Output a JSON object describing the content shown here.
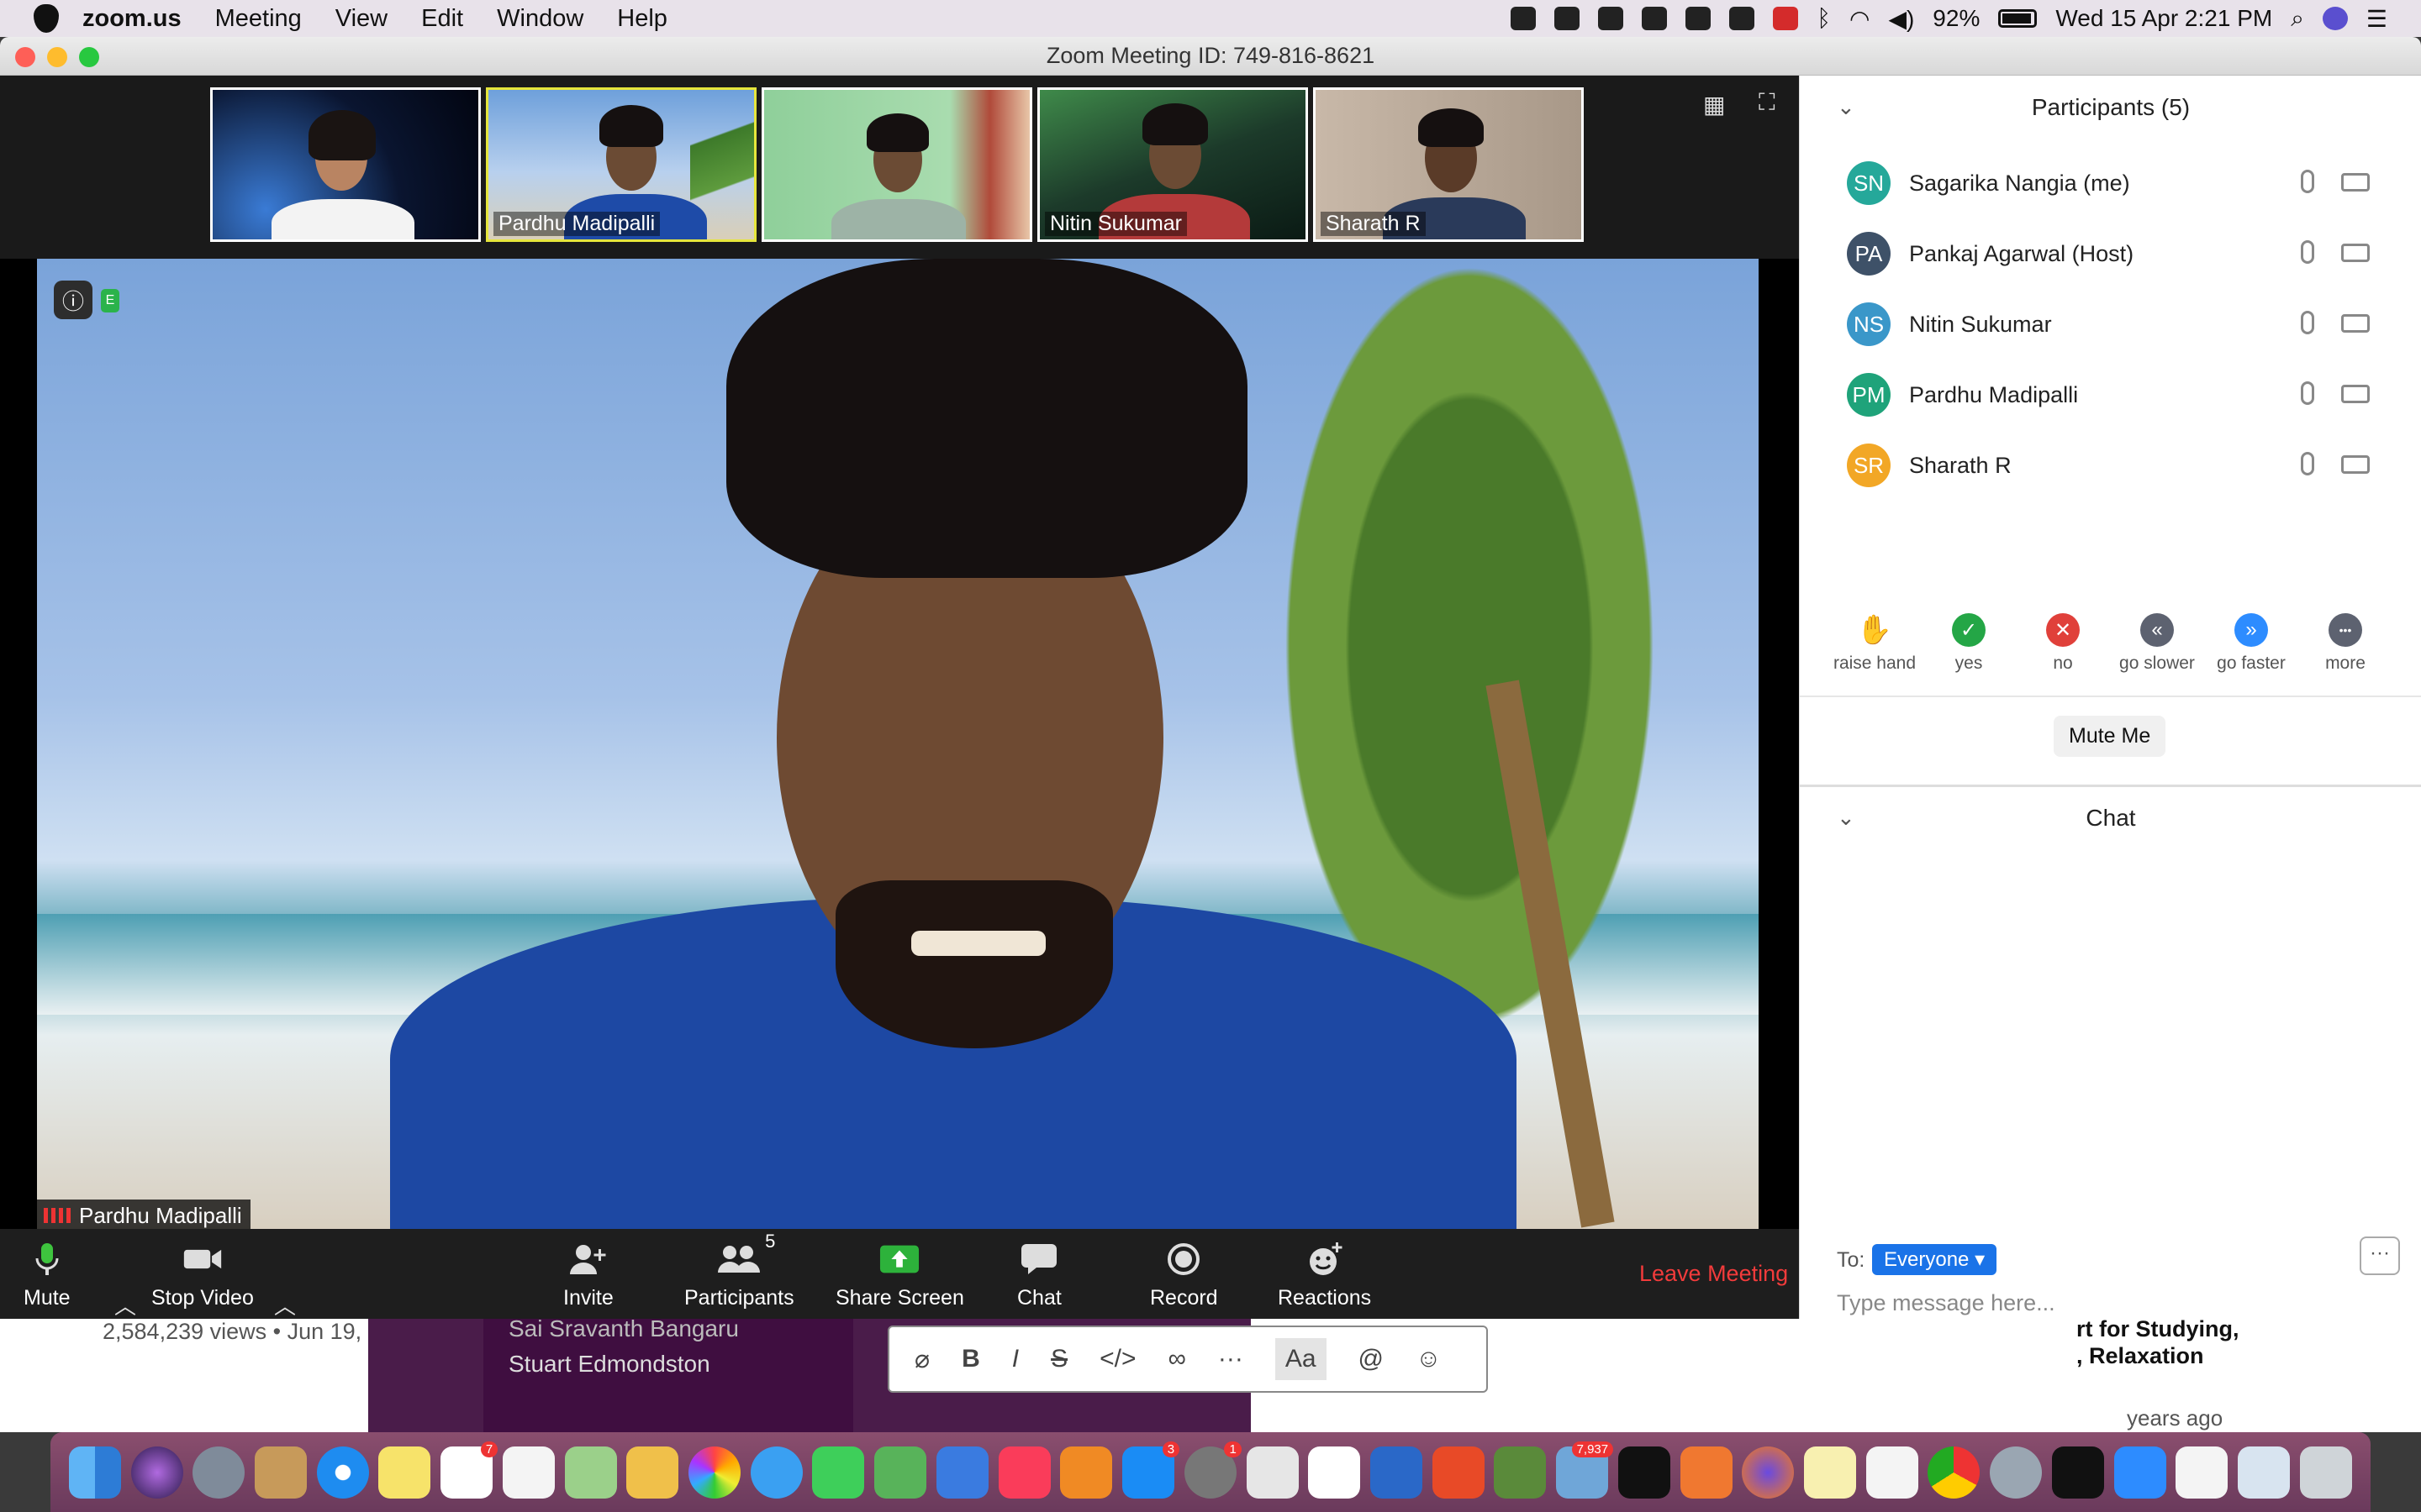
{
  "menubar": {
    "app": "zoom.us",
    "menus": [
      "Meeting",
      "View",
      "Edit",
      "Window",
      "Help"
    ],
    "battery": "92%",
    "datetime": "Wed 15 Apr  2:21 PM"
  },
  "window": {
    "title": "Zoom Meeting ID: 749-816-8621"
  },
  "thumbnails": [
    {
      "name": ""
    },
    {
      "name": "Pardhu Madipalli"
    },
    {
      "name": ""
    },
    {
      "name": "Nitin Sukumar"
    },
    {
      "name": "Sharath R"
    }
  ],
  "active_speaker": {
    "name": "Pardhu Madipalli"
  },
  "toolbar": {
    "mute": "Mute",
    "stop_video": "Stop Video",
    "invite": "Invite",
    "participants": "Participants",
    "participants_count": "5",
    "share_screen": "Share Screen",
    "chat": "Chat",
    "record": "Record",
    "reactions": "Reactions",
    "leave": "Leave Meeting"
  },
  "panel": {
    "participants_title": "Participants (5)",
    "participants": [
      {
        "initials": "SN",
        "name": "Sagarika Nangia (me)",
        "color": "#25a89a"
      },
      {
        "initials": "PA",
        "name": "Pankaj Agarwal (Host)",
        "color": "#3e5168"
      },
      {
        "initials": "NS",
        "name": "Nitin Sukumar",
        "color": "#3a97c9"
      },
      {
        "initials": "PM",
        "name": "Pardhu Madipalli",
        "color": "#1fa37a"
      },
      {
        "initials": "SR",
        "name": "Sharath R",
        "color": "#f2a726"
      }
    ],
    "feedback": [
      {
        "label": "raise hand",
        "glyph": "✋",
        "color": "#1a73e8"
      },
      {
        "label": "yes",
        "glyph": "✓",
        "color": "#24a646"
      },
      {
        "label": "no",
        "glyph": "✕",
        "color": "#e0403a"
      },
      {
        "label": "go slower",
        "glyph": "«",
        "color": "#5d6270"
      },
      {
        "label": "go faster",
        "glyph": "»",
        "color": "#2d8cff"
      },
      {
        "label": "more",
        "glyph": "•••",
        "color": "#5d6270"
      }
    ],
    "mute_me": "Mute Me",
    "chat_title": "Chat",
    "to_label": "To:",
    "to_value": "Everyone",
    "message_placeholder": "Type message here...",
    "more_glyph": "···"
  },
  "background": {
    "yt_views": "2,584,239 views • Jun 19,",
    "slack_user1": "Sai Sravanth Bangaru",
    "slack_user2": "Stuart Edmondston",
    "yt_title": "rt for Studying,\n, Relaxation",
    "yt_ago": "years ago"
  },
  "dock": {
    "calendar_badge": "7",
    "appstore_badge": "3",
    "prefs_badge": "1",
    "mail_badge": "7,937"
  }
}
